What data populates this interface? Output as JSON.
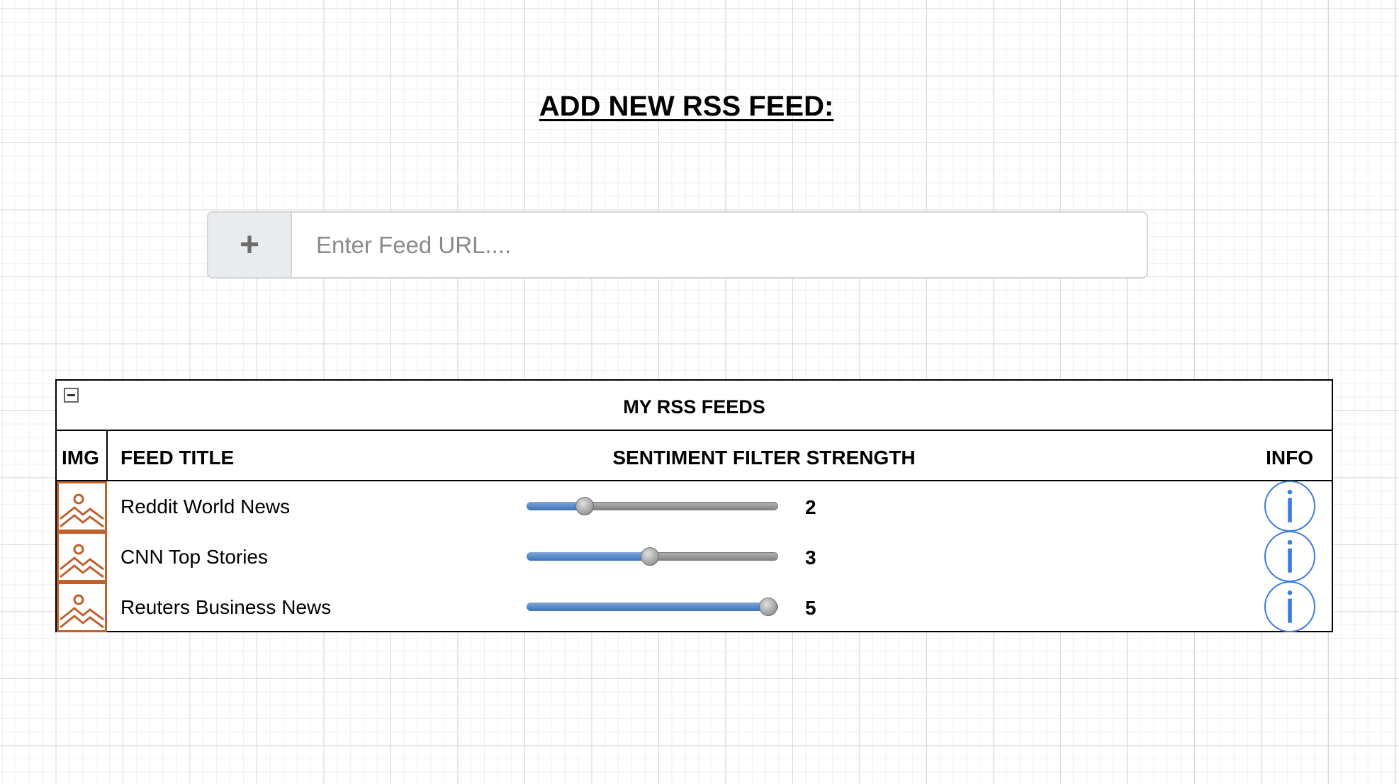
{
  "page": {
    "heading": "ADD NEW RSS FEED:"
  },
  "add_feed": {
    "button_icon": "plus-icon",
    "button_glyph": "+",
    "placeholder": "Enter Feed URL....",
    "value": ""
  },
  "feeds_panel": {
    "title": "MY RSS FEEDS",
    "collapse_icon": "minus-box-icon",
    "columns": {
      "img": "IMG",
      "title": "FEED TITLE",
      "sentiment": "SENTIMENT FILTER STRENGTH",
      "info": "INFO"
    },
    "rows": [
      {
        "title": "Reddit World News",
        "strength": 2,
        "strength_label": "2",
        "thumbnail_icon": "image-placeholder-icon",
        "info_icon": "info-icon"
      },
      {
        "title": "CNN Top Stories",
        "strength": 3,
        "strength_label": "3",
        "thumbnail_icon": "image-placeholder-icon",
        "info_icon": "info-icon"
      },
      {
        "title": "Reuters Business News",
        "strength": 5,
        "strength_label": "5",
        "thumbnail_icon": "image-placeholder-icon",
        "info_icon": "info-icon"
      }
    ],
    "slider_fraction": [
      0.23,
      0.49,
      0.96
    ]
  },
  "colors": {
    "accent_blue": "#3d7de0",
    "slider_fill": "#4a7cc0",
    "thumbnail_orange": "#c0602b"
  }
}
